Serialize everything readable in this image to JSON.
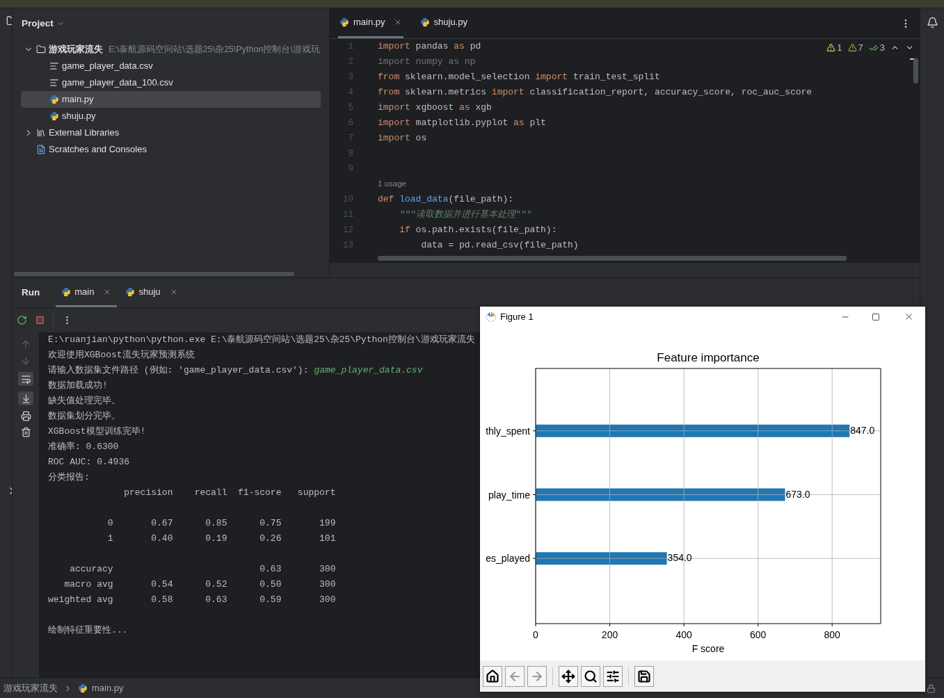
{
  "project_panel": {
    "title": "Project",
    "tree": [
      {
        "label": "游戏玩家流失",
        "path": "E:\\泰航源码空间站\\选题25\\杂25\\Python控制台\\游戏玩",
        "kind": "folder",
        "expanded": true,
        "selected": false,
        "children": [
          {
            "label": "game_player_data.csv",
            "kind": "text",
            "selected": false
          },
          {
            "label": "game_player_data_100.csv",
            "kind": "text",
            "selected": false
          },
          {
            "label": "main.py",
            "kind": "python",
            "selected": true
          },
          {
            "label": "shuju.py",
            "kind": "python",
            "selected": false
          }
        ]
      },
      {
        "label": "External Libraries",
        "kind": "library",
        "expanded": false,
        "selected": false
      },
      {
        "label": "Scratches and Consoles",
        "kind": "scratches",
        "selected": false
      }
    ]
  },
  "editor": {
    "tabs": [
      {
        "label": "main.py",
        "selected": true
      },
      {
        "label": "shuju.py",
        "selected": false
      }
    ],
    "inspections": {
      "warnings": "1",
      "weak_warnings": "7",
      "checks": "3"
    },
    "lines": [
      {
        "kind": "code",
        "number": "1",
        "tokens": [
          {
            "text": "import",
            "kind": "kw"
          },
          {
            "text": " pandas ",
            "kind": "id"
          },
          {
            "text": "as",
            "kind": "kw"
          },
          {
            "text": " pd",
            "kind": "id"
          }
        ]
      },
      {
        "kind": "code",
        "number": "2",
        "tokens": [
          {
            "text": "import numpy as np",
            "kind": "unused"
          }
        ]
      },
      {
        "kind": "code",
        "number": "3",
        "tokens": [
          {
            "text": "from",
            "kind": "kw"
          },
          {
            "text": " sklearn.model_selection ",
            "kind": "id"
          },
          {
            "text": "import",
            "kind": "kw"
          },
          {
            "text": " train_test_split",
            "kind": "id"
          }
        ]
      },
      {
        "kind": "code",
        "number": "4",
        "tokens": [
          {
            "text": "from",
            "kind": "kw"
          },
          {
            "text": " sklearn.metrics ",
            "kind": "id"
          },
          {
            "text": "import",
            "kind": "kw"
          },
          {
            "text": " classification_report, accuracy_score, roc_auc_score",
            "kind": "id"
          }
        ]
      },
      {
        "kind": "code",
        "number": "5",
        "tokens": [
          {
            "text": "import",
            "kind": "kw"
          },
          {
            "text": " xgboost ",
            "kind": "id"
          },
          {
            "text": "as",
            "kind": "kw"
          },
          {
            "text": " xgb",
            "kind": "id"
          }
        ]
      },
      {
        "kind": "code",
        "number": "6",
        "tokens": [
          {
            "text": "import",
            "kind": "kw"
          },
          {
            "text": " matplotlib.pyplot ",
            "kind": "id"
          },
          {
            "text": "as",
            "kind": "kw"
          },
          {
            "text": " plt",
            "kind": "id"
          }
        ]
      },
      {
        "kind": "code",
        "number": "7",
        "tokens": [
          {
            "text": "import",
            "kind": "kw"
          },
          {
            "text": " os",
            "kind": "id"
          }
        ]
      },
      {
        "kind": "code",
        "number": "8"
      },
      {
        "kind": "code",
        "number": "9"
      },
      {
        "kind": "hint",
        "text": "1 usage"
      },
      {
        "kind": "code",
        "number": "10",
        "tokens": [
          {
            "text": "def",
            "kind": "kw"
          },
          {
            "text": " load_data",
            "kind": "fn"
          },
          {
            "text": "(file_path):",
            "kind": "id"
          }
        ]
      },
      {
        "kind": "code",
        "number": "11",
        "tokens": [
          {
            "text": "    \"\"\"读取数据并进行基本处理\"\"\"",
            "kind": "doc"
          }
        ]
      },
      {
        "kind": "code",
        "number": "12",
        "tokens": [
          {
            "text": "    if",
            "kind": "kw"
          },
          {
            "text": " os.path.exists(file_path):",
            "kind": "id"
          }
        ]
      },
      {
        "kind": "code",
        "number": "13",
        "tokens": [
          {
            "text": "        data = pd.read_csv(file_path)",
            "kind": "id"
          }
        ]
      }
    ]
  },
  "run_panel": {
    "title": "Run",
    "tabs": [
      {
        "label": "main",
        "selected": true
      },
      {
        "label": "shuju",
        "selected": false
      }
    ],
    "console": [
      {
        "kind": "output",
        "text": "E:\\ruanjian\\python\\python.exe E:\\泰航源码空间站\\选题25\\杂25\\Python控制台\\游戏玩家流失"
      },
      {
        "kind": "output",
        "text": "欢迎使用XGBoost流失玩家预测系统"
      },
      {
        "kind": "prompt",
        "text": "请输入数据集文件路径 (例如: 'game_player_data.csv'):",
        "input": "game_player_data.csv"
      },
      {
        "kind": "output",
        "text": "数据加载成功!"
      },
      {
        "kind": "output",
        "text": "缺失值处理完毕。"
      },
      {
        "kind": "output",
        "text": "数据集划分完毕。"
      },
      {
        "kind": "output",
        "text": "XGBoost模型训练完毕!"
      },
      {
        "kind": "output",
        "text": "准确率: 0.6300"
      },
      {
        "kind": "output",
        "text": "ROC AUC: 0.4936"
      },
      {
        "kind": "output",
        "text": "分类报告:"
      },
      {
        "kind": "output",
        "text": "              precision    recall  f1-score   support"
      },
      {
        "kind": "blank"
      },
      {
        "kind": "output",
        "text": "           0       0.67      0.85      0.75       199"
      },
      {
        "kind": "output",
        "text": "           1       0.40      0.19      0.26       101"
      },
      {
        "kind": "blank"
      },
      {
        "kind": "output",
        "text": "    accuracy                           0.63       300"
      },
      {
        "kind": "output",
        "text": "   macro avg       0.54      0.52      0.50       300"
      },
      {
        "kind": "output",
        "text": "weighted avg       0.58      0.63      0.59       300"
      },
      {
        "kind": "blank"
      },
      {
        "kind": "output",
        "text": "绘制特征重要性..."
      }
    ]
  },
  "figure_window": {
    "title": "Figure 1",
    "chart_data": {
      "type": "bar",
      "orientation": "horizontal",
      "title": "Feature importance",
      "xlabel": "F score",
      "categories": [
        "thly_spent",
        "play_time",
        "es_played"
      ],
      "series": [
        {
          "color": "#1f77b4",
          "values": [
            847,
            673,
            354
          ]
        }
      ],
      "grid": true,
      "xlim": [
        0,
        931
      ],
      "xticks": [
        0,
        200,
        400,
        600,
        800
      ],
      "value_labels": [
        "847.0",
        "673.0",
        "354.0"
      ]
    },
    "toolbar": [
      {
        "kind": "home",
        "disabled": false
      },
      {
        "kind": "back",
        "disabled": true
      },
      {
        "kind": "forward",
        "disabled": true
      },
      {
        "kind": "pan",
        "disabled": false
      },
      {
        "kind": "zoom",
        "disabled": false
      },
      {
        "kind": "configure",
        "disabled": false
      },
      {
        "kind": "save",
        "disabled": false
      }
    ]
  },
  "status_bar": {
    "breadcrumbs": [
      {
        "label": "游戏玩家流失",
        "kind": "folder"
      },
      {
        "label": "main.py",
        "kind": "python"
      }
    ]
  }
}
